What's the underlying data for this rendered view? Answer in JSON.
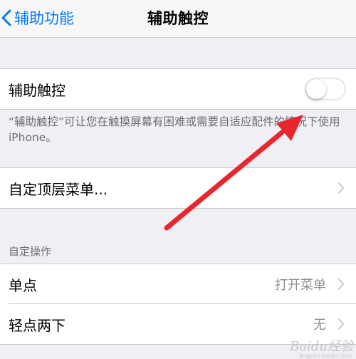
{
  "nav": {
    "back_label": "辅助功能",
    "title": "辅助触控",
    "back_icon": "chevron-left-icon"
  },
  "assistive_touch": {
    "label": "辅助触控",
    "enabled": false,
    "footer": "“辅助触控”可让您在触摸屏幕有困难或需要自适应配件的情况下使用 iPhone。"
  },
  "top_menu": {
    "label": "自定顶层菜单..."
  },
  "custom_actions": {
    "header": "自定操作",
    "rows": [
      {
        "label": "单点",
        "value": "打开菜单"
      },
      {
        "label": "轻点两下",
        "value": "无"
      }
    ]
  },
  "annotation": {
    "color": "#e8262d",
    "icon": "red-arrow"
  },
  "watermark": {
    "brand": "Baidu经验",
    "url": "jingyan.baidu.com"
  },
  "colors": {
    "accent": "#007aff",
    "background": "#efeff4",
    "secondary_text": "#8e8e93"
  }
}
